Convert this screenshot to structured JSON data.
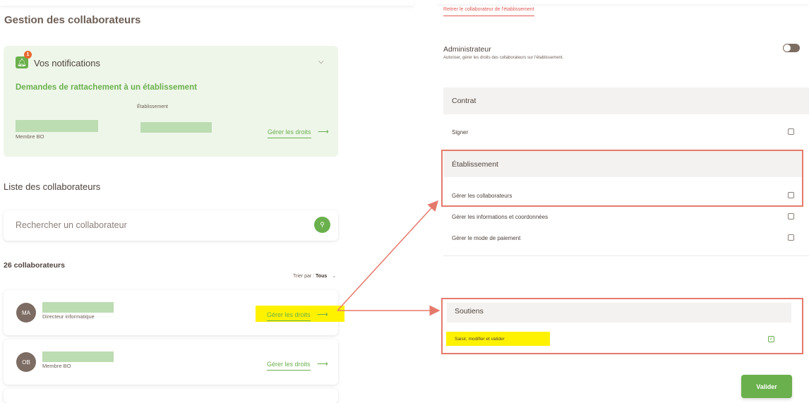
{
  "page": {
    "title": "Gestion des collaborateurs"
  },
  "notifications": {
    "badge_count": "1",
    "title": "Vos notifications",
    "subtitle": "Demandes de rattachement à un établissement",
    "column_label": "Établissement",
    "request": {
      "role": "Membre BO",
      "action_label": "Gérer les droits"
    }
  },
  "list": {
    "title": "Liste des collaborateurs",
    "search_placeholder": "Rechercher un collaborateur",
    "count_label": "26 collaborateurs",
    "sort_prefix": "Trier par :",
    "sort_value": "Tous",
    "items": [
      {
        "initials": "MA",
        "role": "Directeur informatique",
        "action_label": "Gérer les droits"
      },
      {
        "initials": "OB",
        "role": "Membre BO",
        "action_label": "Gérer les droits"
      }
    ]
  },
  "rights_panel": {
    "remove_link": "Retirer le collaborateur de l'établissement",
    "admin": {
      "title": "Administrateur",
      "description": "Autoriser, gérer les droits des collaborateurs sur l'établissement.",
      "enabled": false
    },
    "sections": {
      "contrat": {
        "title": "Contrat",
        "rows": [
          {
            "label": "Signer",
            "checked": false
          }
        ]
      },
      "etablissement": {
        "title": "Établissement",
        "rows": [
          {
            "label": "Gérer les collaborateurs",
            "checked": false
          },
          {
            "label": "Gérer les informations et coordonnées",
            "checked": false
          },
          {
            "label": "Gérer le mode de paiement",
            "checked": false
          }
        ]
      },
      "soutiens": {
        "title": "Soutiens",
        "rows": [
          {
            "label": "Saisir, modifier et valider",
            "checked": true
          }
        ]
      }
    },
    "submit_label": "Valider"
  },
  "colors": {
    "accent_green": "#6ab04c",
    "annotation_red": "#e57a6b",
    "highlight_yellow": "#fff200"
  },
  "icons": {
    "bell": "bell-icon",
    "search": "search-icon",
    "chevron": "chevron-down-icon",
    "arrow": "arrow-right-icon",
    "check": "check-icon"
  }
}
